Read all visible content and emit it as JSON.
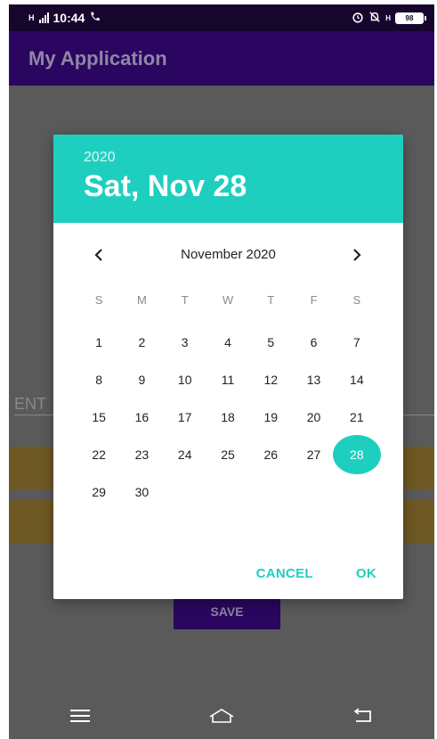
{
  "status_bar": {
    "network": "H",
    "time": "10:44",
    "battery": "98"
  },
  "app_bar": {
    "title": "My Application"
  },
  "background": {
    "input_hint": "ENT",
    "save_label": "SAVE"
  },
  "dialog": {
    "year": "2020",
    "selected_date": "Sat, Nov 28",
    "month_title": "November 2020",
    "weekdays": [
      "S",
      "M",
      "T",
      "W",
      "T",
      "F",
      "S"
    ],
    "weeks": [
      [
        "1",
        "2",
        "3",
        "4",
        "5",
        "6",
        "7"
      ],
      [
        "8",
        "9",
        "10",
        "11",
        "12",
        "13",
        "14"
      ],
      [
        "15",
        "16",
        "17",
        "18",
        "19",
        "20",
        "21"
      ],
      [
        "22",
        "23",
        "24",
        "25",
        "26",
        "27",
        "28"
      ],
      [
        "29",
        "30",
        "",
        "",
        "",
        "",
        ""
      ]
    ],
    "selected_day": "28",
    "cancel_label": "CANCEL",
    "ok_label": "OK"
  },
  "colors": {
    "accent": "#1ecfc0",
    "app_bar": "#2a0660",
    "status_bar": "#16062e"
  }
}
